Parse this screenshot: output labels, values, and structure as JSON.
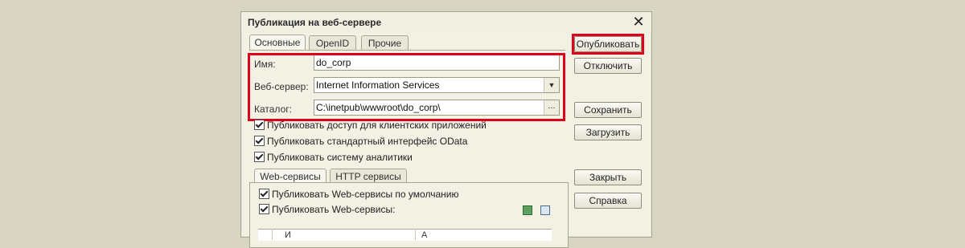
{
  "window": {
    "title": "Публикация на веб-сервере"
  },
  "tabs": [
    {
      "label": "Основные",
      "active": true
    },
    {
      "label": "OpenID",
      "active": false
    },
    {
      "label": "Прочие",
      "active": false
    }
  ],
  "fields": {
    "name": {
      "label": "Имя:",
      "value": "do_corp"
    },
    "webserver": {
      "label": "Веб-сервер:",
      "value": "Internet Information Services"
    },
    "catalog": {
      "label": "Каталог:",
      "value": "C:\\inetpub\\wwwroot\\do_corp\\",
      "button": "..."
    }
  },
  "checkboxes": [
    {
      "label": "Публиковать доступ для клиентских приложений",
      "checked": true
    },
    {
      "label": "Публиковать стандартный интерфейс OData",
      "checked": true
    },
    {
      "label": "Публиковать систему аналитики",
      "checked": true
    }
  ],
  "subtabs": [
    {
      "label": "Web-сервисы",
      "active": true
    },
    {
      "label": "HTTP сервисы",
      "active": false
    }
  ],
  "services": [
    {
      "label": "Публиковать Web-сервисы по умолчанию",
      "checked": true
    },
    {
      "label": "Публиковать Web-сервисы:",
      "checked": true
    }
  ],
  "grid_header": {
    "col1": "И",
    "col2": "А"
  },
  "buttons": {
    "publish": "Опубликовать",
    "disable": "Отключить",
    "save": "Сохранить",
    "load": "Загрузить",
    "close": "Закрыть",
    "help": "Справка"
  },
  "colors": {
    "highlight": "#e0001b",
    "background": "#d8d6c2",
    "dialog": "#f3f1e4"
  },
  "icons": {
    "close": "close-icon",
    "dropdown": "chevron-down-icon",
    "select_all": "check-all-icon",
    "copy": "copy-icon"
  }
}
